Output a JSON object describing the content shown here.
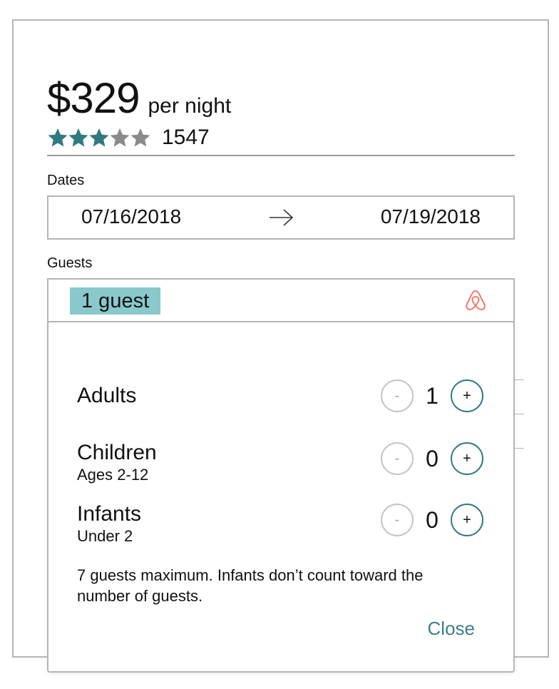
{
  "listing": {
    "price": "$329",
    "per_night": "per night",
    "rating": {
      "stars_filled": 3,
      "stars_total": 5
    },
    "review_count": "1547"
  },
  "dates": {
    "label": "Dates",
    "check_in": "07/16/2018",
    "check_out": "07/19/2018"
  },
  "guests": {
    "label": "Guests",
    "summary": "1 guest",
    "logo": "airbnb-logo"
  },
  "guest_picker": {
    "adults": {
      "title": "Adults",
      "subtitle": "",
      "value": "1"
    },
    "children": {
      "title": "Children",
      "subtitle": "Ages 2-12",
      "value": "0"
    },
    "infants": {
      "title": "Infants",
      "subtitle": "Under 2",
      "value": "0"
    },
    "minus_label": "-",
    "plus_label": "+",
    "note": "7 guests maximum. Infants don’t count toward the number of guests.",
    "close_label": "Close"
  },
  "colors": {
    "star_filled": "#2f7a7f",
    "star_empty": "#8a8a8a",
    "chip_bg": "#89c9cc",
    "accent": "#3b7f84",
    "logo": "#ef7b6e"
  }
}
